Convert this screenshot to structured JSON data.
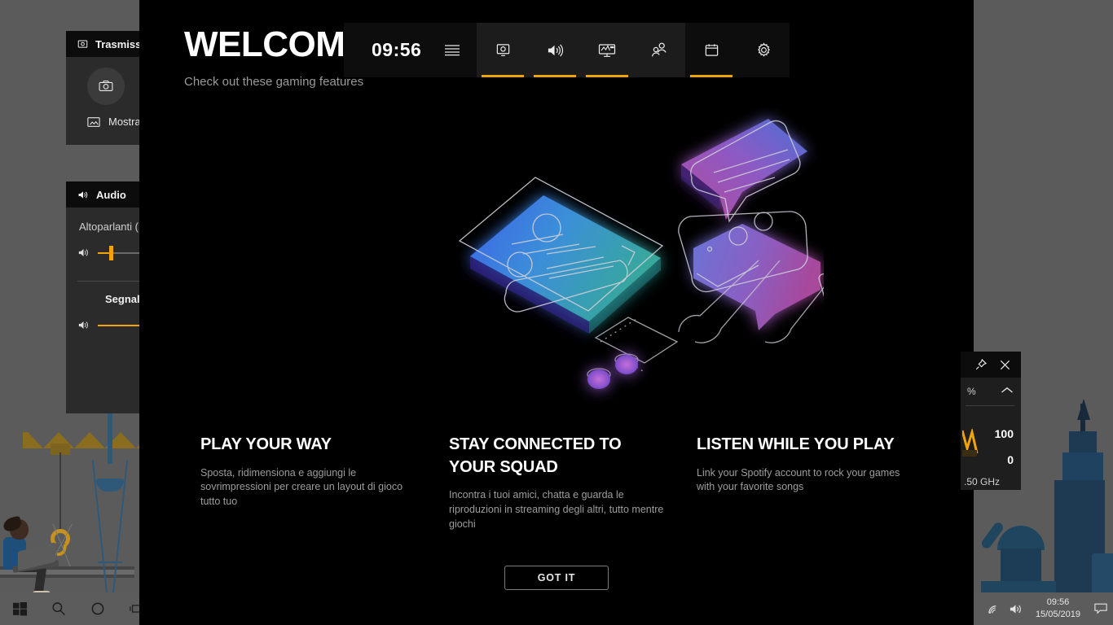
{
  "welcome": {
    "title": "WELCOME",
    "subtitle": "Check out these gaming features",
    "columns": [
      {
        "heading": "PLAY YOUR WAY",
        "body": "Sposta, ridimensiona e aggiungi le sovrimpressioni per creare un layout di gioco tutto tuo"
      },
      {
        "heading": "STAY CONNECTED TO YOUR SQUAD",
        "body": "Incontra i tuoi amici, chatta e guarda le riproduzioni in streaming degli altri, tutto mentre giochi"
      },
      {
        "heading": "LISTEN WHILE YOU PLAY",
        "body": "Link your Spotify account to rock your games with your favorite songs"
      }
    ],
    "got_it_label": "GOT IT"
  },
  "gamebar": {
    "clock": "09:56",
    "menu_icon": "list-icon",
    "tabs": [
      {
        "icon": "capture-icon",
        "name": "capture",
        "active": true
      },
      {
        "icon": "volume-icon",
        "name": "audio",
        "active": true
      },
      {
        "icon": "performance-icon",
        "name": "performance",
        "active": true
      },
      {
        "icon": "people-icon",
        "name": "social",
        "active": false
      },
      {
        "icon": "widget-store-icon",
        "name": "widget-store",
        "active": true
      },
      {
        "icon": "gear-icon",
        "name": "settings",
        "active": false
      }
    ]
  },
  "widgets": {
    "capture": {
      "title": "Trasmissione e acquisizione",
      "title_icon": "capture-icon",
      "screenshot_button_icon": "camera-icon",
      "show_label": "Mostra tutte le acquisizioni",
      "show_icon": "gallery-icon"
    },
    "audio": {
      "title": "Audio",
      "title_icon": "volume-icon",
      "device_label": "Altoparlanti (Realtek High Definition Audio)",
      "device_volume_icon": "volume-icon",
      "device_volume_percent": 12,
      "signal_label": "Segnale acustico Windows",
      "signal_volume_icon": "volume-icon",
      "signal_volume_percent": 100
    }
  },
  "performance_panel": {
    "pin_icon": "pin-icon",
    "close_icon": "close-icon",
    "collapse_icon": "chevron-up-icon",
    "unit_percent": "%",
    "value_top": "100",
    "value_bottom": "0",
    "frequency": ".50 GHz"
  },
  "taskbar": {
    "items": [
      {
        "icon": "windows-start-icon",
        "name": "start-button"
      },
      {
        "icon": "search-icon",
        "name": "search-button"
      },
      {
        "icon": "cortana-icon",
        "name": "cortana-button"
      },
      {
        "icon": "task-view-icon",
        "name": "task-view-button"
      }
    ],
    "tray": {
      "network_icon": "wifi-icon",
      "volume_icon": "volume-icon",
      "time": "09:56",
      "date": "15/05/2019",
      "action_center_icon": "notification-icon"
    }
  },
  "colors": {
    "accent": "#f0a30a",
    "overlay_bg": "#000000",
    "widget_bg": "#2b2b2b",
    "taskbar_bg": "#5c5c5c"
  }
}
